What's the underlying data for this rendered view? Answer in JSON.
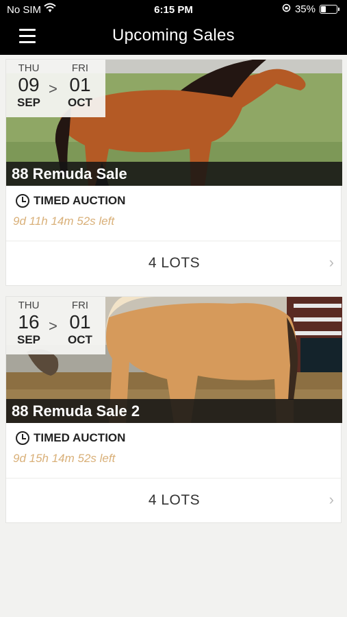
{
  "status_bar": {
    "carrier": "No SIM",
    "time": "6:15 PM",
    "battery_text": "35%",
    "battery_level": 0.35
  },
  "nav": {
    "title": "Upcoming Sales"
  },
  "sales": [
    {
      "start": {
        "dow": "THU",
        "day": "09",
        "mon": "SEP"
      },
      "end": {
        "dow": "FRI",
        "day": "01",
        "mon": "OCT"
      },
      "arrow": ">",
      "name": "88 Remuda Sale",
      "type": "TIMED AUCTION",
      "countdown": "9d 11h 14m 52s left",
      "lots": "4 LOTS"
    },
    {
      "start": {
        "dow": "THU",
        "day": "16",
        "mon": "SEP"
      },
      "end": {
        "dow": "FRI",
        "day": "01",
        "mon": "OCT"
      },
      "arrow": ">",
      "name": "88 Remuda Sale 2",
      "type": "TIMED AUCTION",
      "countdown": "9d 15h 14m 52s left",
      "lots": "4 LOTS"
    }
  ],
  "colors": {
    "countdown": "#d9b079",
    "bar": "#000000",
    "background": "#f2f2f0"
  }
}
